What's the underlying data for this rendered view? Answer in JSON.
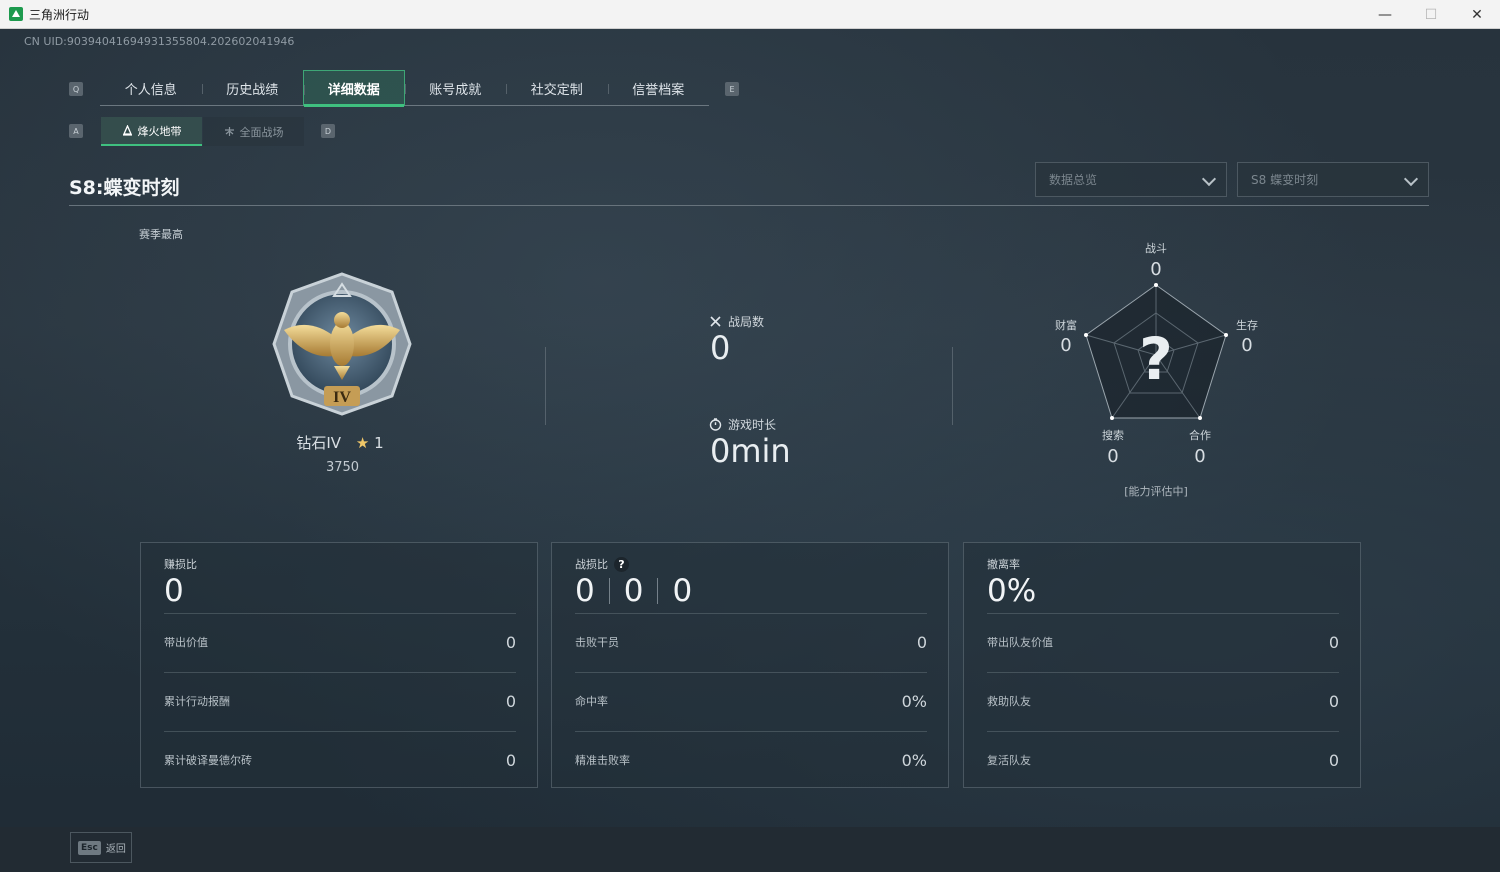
{
  "window": {
    "title": "三角洲行动",
    "controls": {
      "minimize": "—",
      "maximize": "☐",
      "close": "✕"
    }
  },
  "uid": "CN UID:9039404169493135580​4.202602041946",
  "tabs": {
    "left_key": "Q",
    "right_key": "E",
    "items": [
      "个人信息",
      "历史战绩",
      "详细数据",
      "账号成就",
      "社交定制",
      "信誉档案"
    ],
    "active_index": 2
  },
  "subtabs": {
    "left_key": "A",
    "right_key": "D",
    "items": [
      {
        "label": "烽火地带",
        "icon": "hazard-zone-icon",
        "active": true
      },
      {
        "label": "全面战场",
        "icon": "warfare-icon",
        "active": false
      }
    ]
  },
  "season": {
    "title": "S8:蝶变时刻",
    "dropdown_data": "数据总览",
    "dropdown_season": "S8 蝶变时刻",
    "best_label": "赛季最高",
    "rank_name": "钻石IV",
    "rank_stars": "1",
    "rank_score": "3750",
    "medal_numeral": "IV"
  },
  "mid_stats": {
    "matches_label": "战局数",
    "matches_value": "0",
    "playtime_label": "游戏时长",
    "playtime_value": "0min"
  },
  "radar": {
    "axes": [
      {
        "label": "战斗",
        "value": "0"
      },
      {
        "label": "生存",
        "value": "0"
      },
      {
        "label": "合作",
        "value": "0"
      },
      {
        "label": "搜索",
        "value": "0"
      },
      {
        "label": "财富",
        "value": "0"
      }
    ],
    "center_mark": "?",
    "status": "[能力评估中]"
  },
  "panels": [
    {
      "title": "赚损比",
      "big": [
        "0"
      ],
      "rows": [
        {
          "label": "带出价值",
          "value": "0"
        },
        {
          "label": "累计行动报酬",
          "value": "0"
        },
        {
          "label": "累计破译曼德尔砖",
          "value": "0"
        }
      ]
    },
    {
      "title": "战损比",
      "help": "?",
      "big": [
        "0",
        "0",
        "0"
      ],
      "rows": [
        {
          "label": "击败干员",
          "value": "0"
        },
        {
          "label": "命中率",
          "value": "0%"
        },
        {
          "label": "精准击败率",
          "value": "0%"
        }
      ]
    },
    {
      "title": "撤离率",
      "big": [
        "0%"
      ],
      "rows": [
        {
          "label": "带出队友价值",
          "value": "0"
        },
        {
          "label": "救助队友",
          "value": "0"
        },
        {
          "label": "复活队友",
          "value": "0"
        }
      ]
    }
  ],
  "footer": {
    "esc_key": "Esc",
    "back_label": "返回"
  },
  "colors": {
    "accent_green": "#3fc07f",
    "background": "#24313b",
    "star_gold": "#f0c768"
  }
}
